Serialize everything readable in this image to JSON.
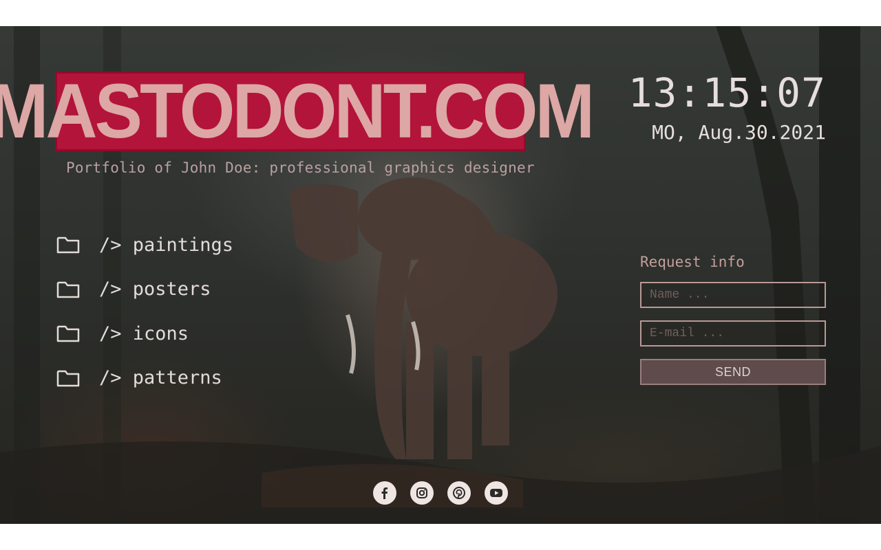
{
  "brand": {
    "title": "MASTODONT.COM",
    "subtitle": "Portfolio of John Doe: professional graphics designer",
    "accent_color": "#b3143a",
    "title_color": "#dca7a5"
  },
  "clock": {
    "time": "13:15:07",
    "date": "MO, Aug.30.2021"
  },
  "nav": {
    "items": [
      {
        "label": "/> paintings",
        "icon": "folder-icon"
      },
      {
        "label": "/> posters",
        "icon": "folder-icon"
      },
      {
        "label": "/> icons",
        "icon": "folder-icon"
      },
      {
        "label": "/> patterns",
        "icon": "folder-icon"
      }
    ]
  },
  "form": {
    "title": "Request info",
    "name_placeholder": "Name ...",
    "email_placeholder": "E-mail ...",
    "send_label": "SEND"
  },
  "social": {
    "icons": [
      "facebook-icon",
      "instagram-icon",
      "pinterest-icon",
      "youtube-icon"
    ]
  }
}
